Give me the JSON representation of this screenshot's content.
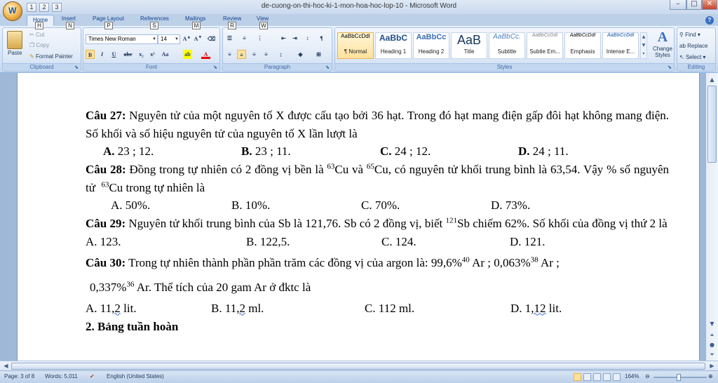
{
  "window": {
    "title": "de-cuong-on-thi-hoc-ki-1-mon-hoa-hoc-lop-10 - Microsoft Word",
    "office_button_label": "W",
    "qat": [
      "1",
      "2",
      "3"
    ],
    "min_label": "–",
    "max_label": "□",
    "close_label": "✕"
  },
  "tabs": [
    {
      "label": "Home",
      "key": "H"
    },
    {
      "label": "Insert",
      "key": "N"
    },
    {
      "label": "Page Layout",
      "key": "P"
    },
    {
      "label": "References",
      "key": "S"
    },
    {
      "label": "Mailings",
      "key": "M"
    },
    {
      "label": "Review",
      "key": "R"
    },
    {
      "label": "View",
      "key": "W"
    }
  ],
  "ribbon": {
    "clipboard": {
      "label": "Clipboard",
      "paste": "Paste",
      "cut": "Cut",
      "copy": "Copy",
      "format_painter": "Format Painter"
    },
    "font": {
      "label": "Font",
      "font_name": "Times New Roman",
      "font_size": "14"
    },
    "paragraph": {
      "label": "Paragraph"
    },
    "styles": {
      "label": "Styles",
      "items": [
        {
          "sample": "AaBbCcDdI",
          "name": "¶ Normal"
        },
        {
          "sample": "AaBbC",
          "name": "Heading 1"
        },
        {
          "sample": "AaBbCc",
          "name": "Heading 2"
        },
        {
          "sample": "AaB",
          "name": "Title"
        },
        {
          "sample": "AaBbCc.",
          "name": "Subtitle"
        },
        {
          "sample": "AaBbCcDdI",
          "name": "Subtle Em..."
        },
        {
          "sample": "AaBbCcDdI",
          "name": "Emphasis"
        },
        {
          "sample": "AaBbCcDdI",
          "name": "Intense E..."
        }
      ],
      "change_styles": "Change Styles"
    },
    "editing": {
      "label": "Editing",
      "find": "Find",
      "replace": "Replace",
      "select": "Select"
    }
  },
  "document": {
    "q27": {
      "num": "Câu 27:",
      "text": "Nguyên tử của một nguyên tố X được cấu tạo bởi 36 hạt. Trong đó hạt mang điện gấp đôi hạt không mang điện. Số khối và số hiệu nguyên tử của nguyên tố X lần lượt là",
      "options": [
        {
          "letter": "A.",
          "text": "23 ; 12."
        },
        {
          "letter": "B.",
          "text": "23 ; 11."
        },
        {
          "letter": "C.",
          "text": "24 ; 12."
        },
        {
          "letter": "D.",
          "text": "24 ; 11."
        }
      ]
    },
    "q28": {
      "num": "Câu 28:",
      "t1": "Đồng trong tự nhiên có 2 đồng vị bền là",
      "iso1": "63",
      "t2": "Cu và",
      "iso2": "65",
      "t3": "Cu, có nguyên tử khối trung bình là 63,54. Vậy % số nguyên tử",
      "iso3": "63",
      "t4": "Cu trong tự nhiên là",
      "options": [
        "A. 50%.",
        "B. 10%.",
        "C. 70%.",
        "D. 73%."
      ]
    },
    "q29": {
      "num": "Câu 29:",
      "t1": "Nguyên tử khối trung bình của Sb là 121,76. Sb có 2 đồng vị, biết",
      "iso": "121",
      "t2": "Sb chiếm 62%. Số khối của đồng vị thứ 2 là",
      "options": [
        "A. 123.",
        "B. 122,5.",
        "C. 124.",
        "D. 121."
      ]
    },
    "q30": {
      "num": "Câu 30:",
      "t1": "Trong tự nhiên thành phần phần trăm các đồng vị của argon là: 99,6%",
      "iso1": "40",
      "t2": "Ar ; 0,063%",
      "iso2": "38",
      "t3": "Ar ;",
      "line2_pct": "0,337%",
      "iso3": "36",
      "line2_text": "Ar. Thể tích của 20 gam Ar ở đktc là",
      "options": [
        {
          "prefix": "A. 11",
          "sq": ",2",
          "suffix": " lit."
        },
        {
          "prefix": "B. 11",
          "sq": ",2",
          "suffix": " ml."
        },
        {
          "prefix": "C. 112 ml.",
          "sq": "",
          "suffix": ""
        },
        {
          "prefix": "D. 1",
          "sq": ",12",
          "suffix": " lit."
        }
      ]
    },
    "section_heading": "2. Bảng tuần hoàn"
  },
  "status": {
    "page": "Page: 3 of 8",
    "words": "Words: 5,011",
    "language": "English (United States)",
    "zoom": "164%"
  }
}
